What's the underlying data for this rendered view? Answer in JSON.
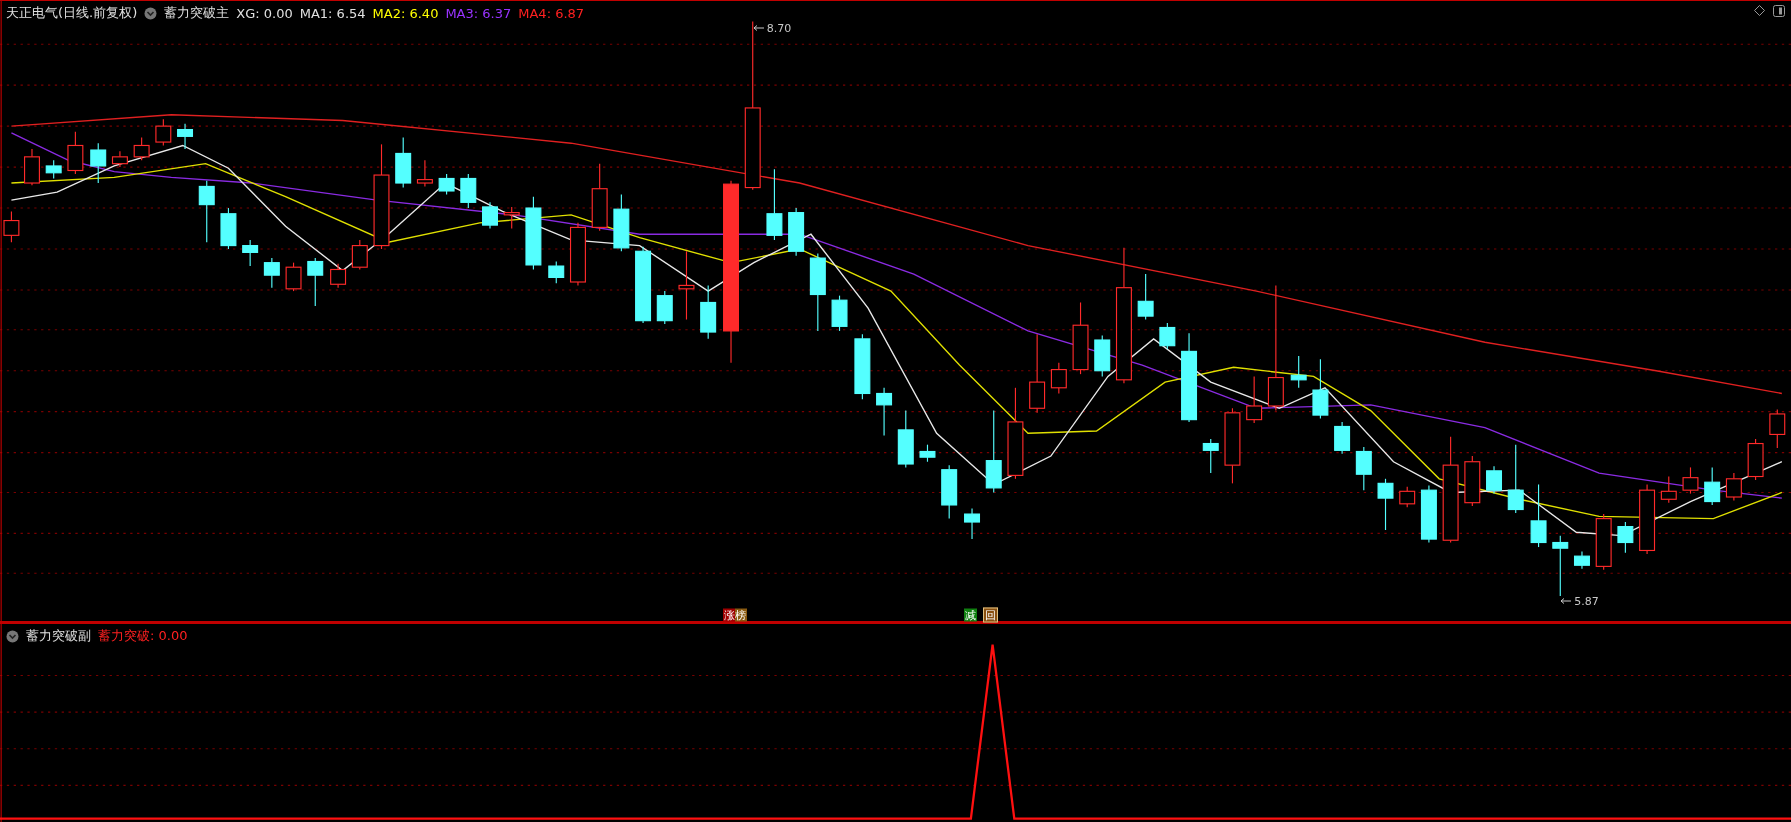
{
  "main_panel": {
    "stock_title": "天正电气(日线.前复权)",
    "indicator_name": "蓄力突破主",
    "values": [
      {
        "label": "XG: 0.00",
        "color": "#e0e0e0"
      },
      {
        "label": "MA1: 6.54",
        "color": "#e0e0e0"
      },
      {
        "label": "MA2: 6.40",
        "color": "#ffff00"
      },
      {
        "label": "MA3: 6.37",
        "color": "#9933ff"
      },
      {
        "label": "MA4: 6.87",
        "color": "#ff2020"
      }
    ],
    "high_label": "8.70",
    "low_label": "5.87",
    "signals": [
      {
        "text": "涨榜",
        "kind": "limit"
      },
      {
        "text": "减",
        "kind": "reduce"
      },
      {
        "text": "回",
        "kind": "back"
      }
    ]
  },
  "sub_panel": {
    "indicator_name": "蓄力突破副",
    "values": [
      {
        "label": "蓄力突破: 0.00",
        "color": "#ff2020"
      }
    ]
  }
}
